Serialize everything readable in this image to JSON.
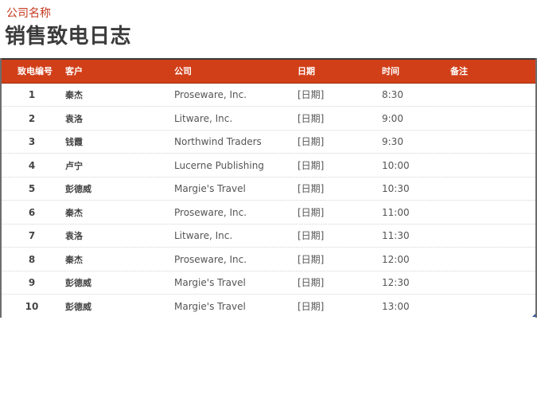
{
  "header": {
    "company": "公司名称",
    "title": "销售致电日志"
  },
  "table": {
    "columns": [
      "致电编号",
      "客户",
      "公司",
      "日期",
      "时间",
      "备注"
    ],
    "rows": [
      {
        "num": "1",
        "customer": "秦杰",
        "company": "Proseware, Inc.",
        "date": "[日期]",
        "time": "8:30",
        "note": ""
      },
      {
        "num": "2",
        "customer": "袁洛",
        "company": "Litware, Inc.",
        "date": "[日期]",
        "time": "9:00",
        "note": ""
      },
      {
        "num": "3",
        "customer": "钱霞",
        "company": "Northwind Traders",
        "date": "[日期]",
        "time": "9:30",
        "note": ""
      },
      {
        "num": "4",
        "customer": "卢宁",
        "company": "Lucerne Publishing",
        "date": "[日期]",
        "time": "10:00",
        "note": ""
      },
      {
        "num": "5",
        "customer": "彭德威",
        "company": "Margie's Travel",
        "date": "[日期]",
        "time": "10:30",
        "note": ""
      },
      {
        "num": "6",
        "customer": "秦杰",
        "company": "Proseware, Inc.",
        "date": "[日期]",
        "time": "11:00",
        "note": ""
      },
      {
        "num": "7",
        "customer": "袁洛",
        "company": "Litware, Inc.",
        "date": "[日期]",
        "time": "11:30",
        "note": ""
      },
      {
        "num": "8",
        "customer": "秦杰",
        "company": "Proseware, Inc.",
        "date": "[日期]",
        "time": "12:00",
        "note": ""
      },
      {
        "num": "9",
        "customer": "彭德威",
        "company": "Margie's Travel",
        "date": "[日期]",
        "time": "12:30",
        "note": ""
      },
      {
        "num": "10",
        "customer": "彭德威",
        "company": "Margie's Travel",
        "date": "[日期]",
        "time": "13:00",
        "note": ""
      }
    ]
  },
  "colors": {
    "accent": "#d13f19",
    "company_text": "#c5381f",
    "title_text": "#3b3b3b"
  }
}
